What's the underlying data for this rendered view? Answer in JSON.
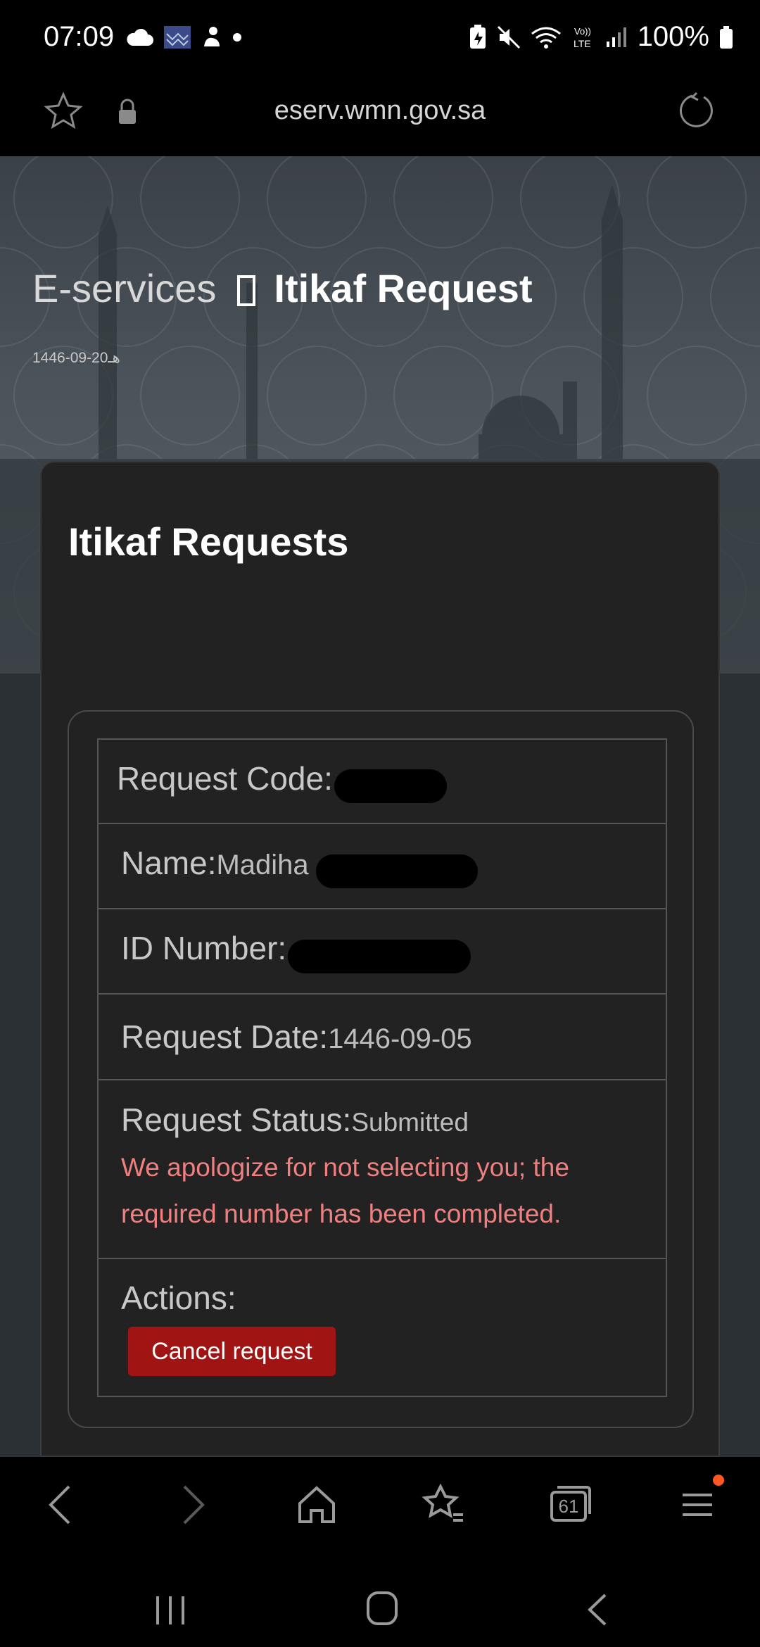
{
  "status_bar": {
    "time": "07:09",
    "battery": "100%",
    "icons": [
      "cloud-icon",
      "app-icon",
      "hand-icon",
      "dot-icon",
      "battery-saver-icon",
      "mute-icon",
      "wifi-icon",
      "volte-icon",
      "signal-icon",
      "battery-icon"
    ]
  },
  "browser": {
    "url": "eserv.wmn.gov.sa",
    "icons": [
      "star-icon",
      "lock-icon",
      "reload-icon"
    ]
  },
  "hero": {
    "breadcrumb_root": "E-services",
    "breadcrumb_current": "Itikaf Request",
    "hijri_date": "1446-09-20هـ"
  },
  "card": {
    "title": "Itikaf Requests",
    "rows": {
      "request_code_label": "Request Code:",
      "name_label": "Name:",
      "name_value": "Madiha",
      "id_label": "ID Number:",
      "date_label": "Request Date:",
      "date_value": "1446-09-05",
      "status_label": "Request Status:",
      "status_value": "Submitted",
      "status_message": "We apologize for not selecting you; the required number has been completed.",
      "actions_label": "Actions:",
      "cancel_button": "Cancel request"
    }
  },
  "bottom_nav": {
    "tabs_count": "61",
    "icons": [
      "back-icon",
      "forward-icon",
      "home-icon",
      "bookmarks-icon",
      "tabs-icon",
      "menu-icon"
    ]
  },
  "colors": {
    "accent_red": "#a11414",
    "error_text": "#f08080",
    "notification_dot": "#ff5722"
  }
}
